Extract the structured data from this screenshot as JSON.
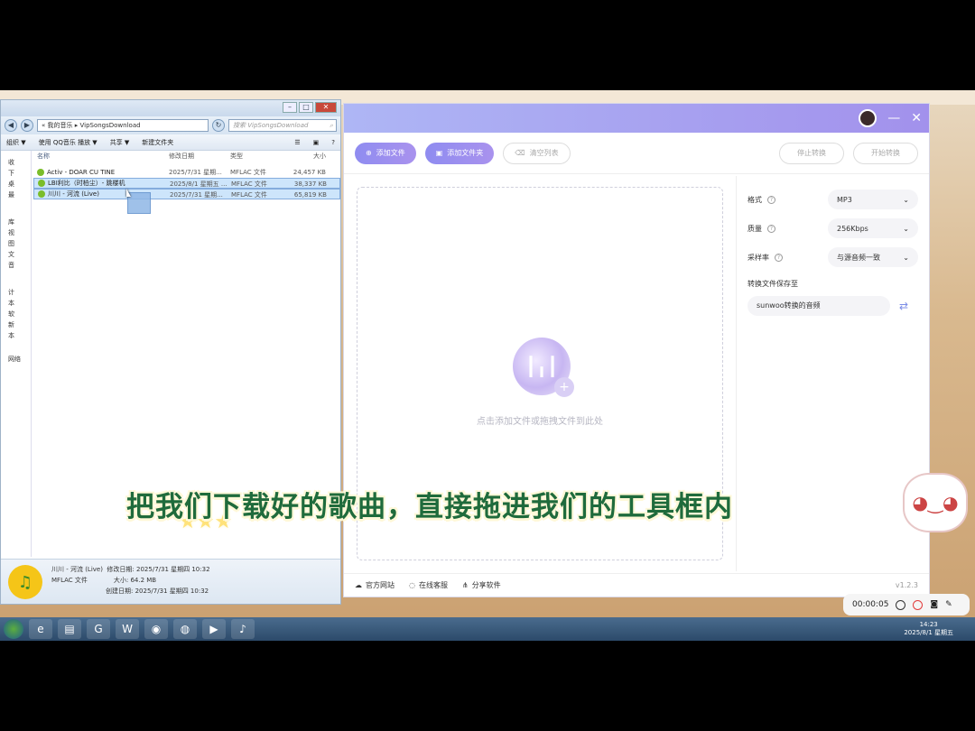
{
  "explorer": {
    "address_prefix": "« 我的音乐 ▸ ",
    "address": "VipSongsDownload",
    "search_placeholder": "搜索 VipSongsDownload",
    "toolbar": {
      "organize": "组织 ▼",
      "qq_play": "使用 QQ音乐 播放 ▼",
      "share": "共享 ▼",
      "new_folder": "新建文件夹"
    },
    "columns": {
      "name": "名称",
      "date": "修改日期",
      "type": "类型",
      "size": "大小"
    },
    "files": [
      {
        "name": "Activ - DOAR CU TINE",
        "date": "2025/7/31 星期...",
        "type": "MFLAC 文件",
        "size": "24,457 KB"
      },
      {
        "name": "LBI利比（时柏尘）- 跳楼机",
        "date": "2025/8/1 星期五 ...",
        "type": "MFLAC 文件",
        "size": "38,337 KB"
      },
      {
        "name": "川川 - 河流 (Live)",
        "date": "2025/7/31 星期...",
        "type": "MFLAC 文件",
        "size": "65,819 KB"
      }
    ],
    "nav": [
      "收",
      "下",
      "桌",
      "最",
      "库",
      "视",
      "图",
      "文",
      "音",
      "计",
      "本",
      "软",
      "新",
      "本",
      "网络"
    ],
    "details": {
      "name": "川川 - 河流 (Live)",
      "kind": "MFLAC 文件",
      "modified_label": "修改日期:",
      "modified": "2025/7/31 星期四 10:32",
      "size_label": "大小:",
      "size": "64.2 MB",
      "created_label": "创建日期:",
      "created": "2025/7/31 星期四 10:32"
    }
  },
  "app": {
    "toolbar": {
      "add_file": "添加文件",
      "add_folder": "添加文件夹",
      "clear_list": "清空列表",
      "stop_convert": "停止转换",
      "start_convert": "开始转换"
    },
    "drop_hint": "点击添加文件或拖拽文件到此处",
    "settings": {
      "format_label": "格式",
      "format_value": "MP3",
      "quality_label": "质量",
      "quality_value": "256Kbps",
      "sample_label": "采样率",
      "sample_value": "与源音频一致",
      "save_label": "转换文件保存至",
      "save_path": "sunwoo转换的音频"
    },
    "footer": {
      "website": "官方网站",
      "support": "在线客服",
      "share": "分享软件",
      "version": "v1.2.3"
    }
  },
  "subtitle": "把我们下载好的歌曲，直接拖进我们的工具框内",
  "recorder": {
    "time": "00:00:05"
  },
  "taskbar": {
    "time": "14:23",
    "date": "2025/8/1 星期五"
  },
  "colors": {
    "accent": "#9a8ff0",
    "subtitle_text": "#1f6b3c",
    "selection": "#cde5fb"
  }
}
